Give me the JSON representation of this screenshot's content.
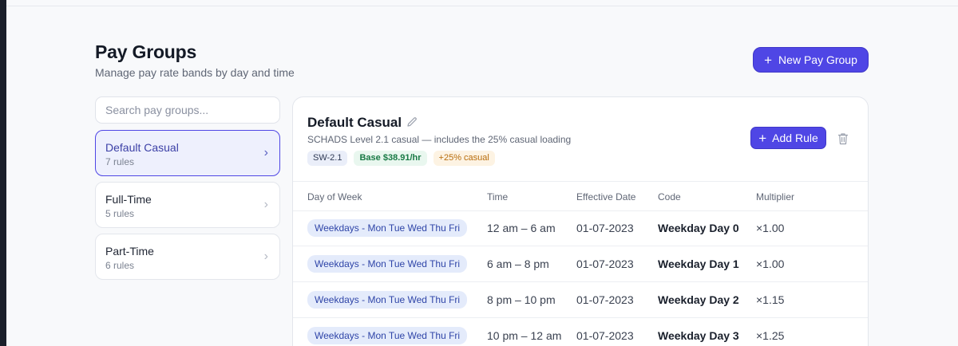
{
  "header": {
    "title": "Pay Groups",
    "subtitle": "Manage pay rate bands by day and time",
    "new_button": "New Pay Group"
  },
  "sidebar": {
    "search_placeholder": "Search pay groups...",
    "groups": [
      {
        "name": "Default Casual",
        "count": "7 rules",
        "active": true
      },
      {
        "name": "Full-Time",
        "count": "5 rules",
        "active": false
      },
      {
        "name": "Part-Time",
        "count": "6 rules",
        "active": false
      }
    ]
  },
  "detail": {
    "title": "Default Casual",
    "description": "SCHADS Level 2.1 casual — includes the 25% casual loading",
    "badges": {
      "code": "SW-2.1",
      "base": "Base $38.91/hr",
      "loading": "+25% casual"
    },
    "add_rule": "Add Rule",
    "columns": [
      "Day of Week",
      "Time",
      "Effective Date",
      "Code",
      "Multiplier"
    ],
    "rows": [
      {
        "day": "Weekdays - Mon Tue Wed Thu Fri",
        "time": "12 am – 6 am",
        "effective": "01-07-2023",
        "code": "Weekday Day 0",
        "multiplier": "×1.00"
      },
      {
        "day": "Weekdays - Mon Tue Wed Thu Fri",
        "time": "6 am – 8 pm",
        "effective": "01-07-2023",
        "code": "Weekday Day 1",
        "multiplier": "×1.00"
      },
      {
        "day": "Weekdays - Mon Tue Wed Thu Fri",
        "time": "8 pm – 10 pm",
        "effective": "01-07-2023",
        "code": "Weekday Day 2",
        "multiplier": "×1.15"
      },
      {
        "day": "Weekdays - Mon Tue Wed Thu Fri",
        "time": "10 pm – 12 am",
        "effective": "01-07-2023",
        "code": "Weekday Day 3",
        "multiplier": "×1.25"
      }
    ]
  },
  "colors": {
    "accent": "#4f46e5",
    "active_bg": "#eef0fd",
    "day_pill": "#e4ebfb"
  },
  "icons": {
    "pencil": "pencil-icon",
    "trash": "trash-icon",
    "chevron": "chevron-right-icon",
    "plus": "plus-icon"
  }
}
